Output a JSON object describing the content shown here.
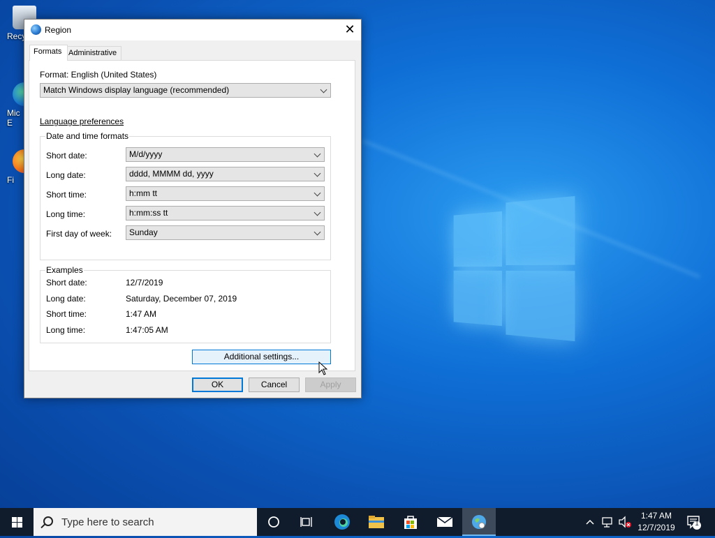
{
  "desktop": {
    "icons": [
      {
        "label": "Recy",
        "icon": "recycle-bin-icon"
      },
      {
        "label": "Mic\nE",
        "icon": "edge-icon"
      },
      {
        "label": "Fi",
        "icon": "firefox-icon"
      }
    ]
  },
  "dialog": {
    "title": "Region",
    "close_glyph": "✕",
    "tabs": [
      {
        "label": "Formats",
        "active": true
      },
      {
        "label": "Administrative",
        "active": false
      }
    ],
    "format": {
      "label": "Format: English (United States)",
      "selected": "Match Windows display language (recommended)"
    },
    "language_link": "Language preferences",
    "date_time_formats": {
      "legend": "Date and time formats",
      "rows": [
        {
          "label": "Short date:",
          "value": "M/d/yyyy"
        },
        {
          "label": "Long date:",
          "value": "dddd, MMMM dd, yyyy"
        },
        {
          "label": "Short time:",
          "value": "h:mm tt"
        },
        {
          "label": "Long time:",
          "value": "h:mm:ss tt"
        },
        {
          "label": "First day of week:",
          "value": "Sunday"
        }
      ]
    },
    "examples": {
      "legend": "Examples",
      "rows": [
        {
          "label": "Short date:",
          "value": "12/7/2019"
        },
        {
          "label": "Long date:",
          "value": "Saturday, December 07, 2019"
        },
        {
          "label": "Short time:",
          "value": "1:47 AM"
        },
        {
          "label": "Long time:",
          "value": "1:47:05 AM"
        }
      ]
    },
    "additional_settings": "Additional settings...",
    "buttons": {
      "ok": "OK",
      "cancel": "Cancel",
      "apply": "Apply"
    }
  },
  "taskbar": {
    "search_placeholder": "Type here to search",
    "clock": {
      "time": "1:47 AM",
      "date": "12/7/2019"
    },
    "notification_count": "1",
    "accent_color": "#76b9ed"
  }
}
